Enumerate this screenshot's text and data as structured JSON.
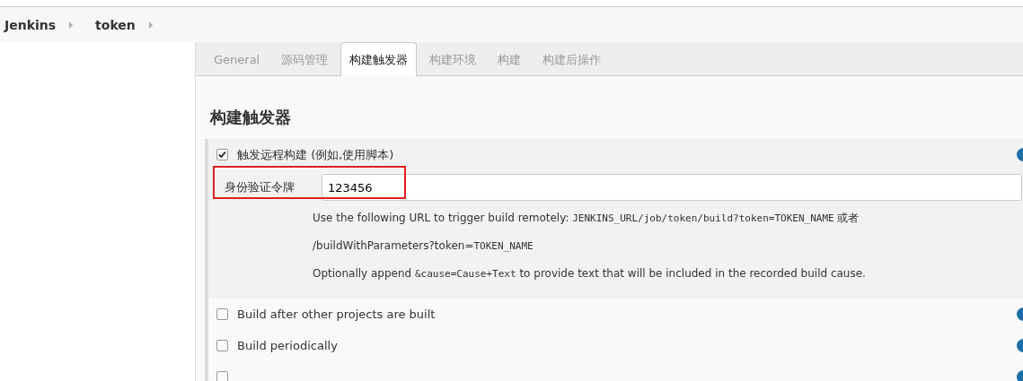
{
  "breadcrumbs": [
    "Jenkins",
    "token"
  ],
  "tabs": [
    {
      "label": "General",
      "selected": false
    },
    {
      "label": "源码管理",
      "selected": false
    },
    {
      "label": "构建触发器",
      "selected": true
    },
    {
      "label": "构建环境",
      "selected": false
    },
    {
      "label": "构建",
      "selected": false
    },
    {
      "label": "构建后操作",
      "selected": false
    }
  ],
  "section_title": "构建触发器",
  "triggers": [
    {
      "label": "触发远程构建 (例如,使用脚本)",
      "checked": true,
      "token_field": {
        "label": "身份验证令牌",
        "value": "123456",
        "highlighted": true
      },
      "help_lines": [
        [
          {
            "kind": "text",
            "text": "Use the following URL to trigger build remotely: "
          },
          {
            "kind": "code",
            "text": "JENKINS_URL/job/token/build?token=TOKEN_NAME"
          },
          {
            "kind": "text",
            "text": " 或者"
          }
        ],
        [
          {
            "kind": "text",
            "text": "/buildWithParameters?token="
          },
          {
            "kind": "code",
            "text": "TOKEN_NAME"
          }
        ],
        [
          {
            "kind": "text",
            "text": "Optionally append "
          },
          {
            "kind": "code",
            "text": "&cause=Cause+Text"
          },
          {
            "kind": "text",
            "text": " to provide text that will be included in the recorded build cause."
          }
        ]
      ]
    },
    {
      "label": "Build after other projects are built",
      "checked": false
    },
    {
      "label": "Build periodically",
      "checked": false
    },
    {
      "checked": false
    }
  ]
}
